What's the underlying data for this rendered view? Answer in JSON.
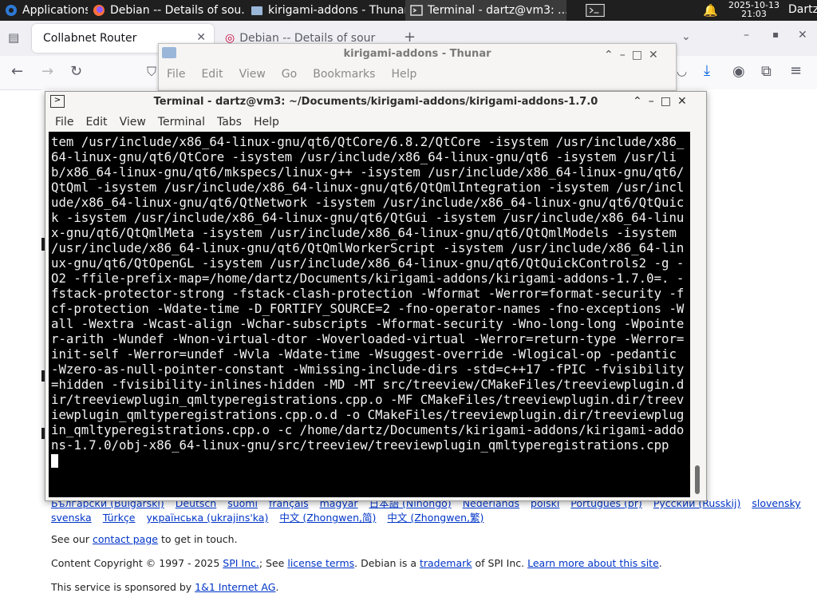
{
  "panel": {
    "apps_label": "Applications",
    "tasks": [
      {
        "label": "Debian -- Details of sou..."
      },
      {
        "label": "kirigami-addons - Thunar"
      },
      {
        "label": "Terminal - dartz@vm3: ..."
      }
    ],
    "date": "2025-10-13",
    "time": "21:03",
    "user": "Dartz"
  },
  "firefox": {
    "tab1_label": "Collabnet Router",
    "tab2_label": "Debian -- Details of sour"
  },
  "thunar": {
    "title": "kirigami-addons - Thunar",
    "menu": [
      "File",
      "Edit",
      "View",
      "Go",
      "Bookmarks",
      "Help"
    ]
  },
  "terminal": {
    "title": "Terminal - dartz@vm3: ~/Documents/kirigami-addons/kirigami-addons-1.7.0",
    "menu": [
      "File",
      "Edit",
      "View",
      "Terminal",
      "Tabs",
      "Help"
    ],
    "output": "tem /usr/include/x86_64-linux-gnu/qt6/QtCore/6.8.2/QtCore -isystem /usr/include/x86_64-linux-gnu/qt6/QtCore -isystem /usr/include/x86_64-linux-gnu/qt6 -isystem /usr/lib/x86_64-linux-gnu/qt6/mkspecs/linux-g++ -isystem /usr/include/x86_64-linux-gnu/qt6/QtQml -isystem /usr/include/x86_64-linux-gnu/qt6/QtQmlIntegration -isystem /usr/include/x86_64-linux-gnu/qt6/QtNetwork -isystem /usr/include/x86_64-linux-gnu/qt6/QtQuick -isystem /usr/include/x86_64-linux-gnu/qt6/QtGui -isystem /usr/include/x86_64-linux-gnu/qt6/QtQmlMeta -isystem /usr/include/x86_64-linux-gnu/qt6/QtQmlModels -isystem /usr/include/x86_64-linux-gnu/qt6/QtQmlWorkerScript -isystem /usr/include/x86_64-linux-gnu/qt6/QtOpenGL -isystem /usr/include/x86_64-linux-gnu/qt6/QtQuickControls2 -g -O2 -ffile-prefix-map=/home/dartz/Documents/kirigami-addons/kirigami-addons-1.7.0=. -fstack-protector-strong -fstack-clash-protection -Wformat -Werror=format-security -fcf-protection -Wdate-time -D_FORTIFY_SOURCE=2 -fno-operator-names -fno-exceptions -Wall -Wextra -Wcast-align -Wchar-subscripts -Wformat-security -Wno-long-long -Wpointer-arith -Wundef -Wnon-virtual-dtor -Woverloaded-virtual -Werror=return-type -Werror=init-self -Werror=undef -Wvla -Wdate-time -Wsuggest-override -Wlogical-op -pedantic -Wzero-as-null-pointer-constant -Wmissing-include-dirs -std=c++17 -fPIC -fvisibility=hidden -fvisibility-inlines-hidden -MD -MT src/treeview/CMakeFiles/treeviewplugin.dir/treeviewplugin_qmltyperegistrations.cpp.o -MF CMakeFiles/treeviewplugin.dir/treeviewplugin_qmltyperegistrations.cpp.o.d -o CMakeFiles/treeviewplugin.dir/treeviewplugin_qmltyperegistrations.cpp.o -c /home/dartz/Documents/kirigami-addons/kirigami-addons-1.7.0/obj-x86_64-linux-gnu/src/treeview/treeviewplugin_qmltyperegistrations.cpp"
  },
  "web": {
    "lang_row1": [
      "Български (Bulgarski)",
      "Deutsch",
      "suomi",
      "français",
      "magyar",
      "日本語 (Nihongo)",
      "Nederlands",
      "polski",
      "Português (br)",
      "Русский (Russkij)",
      "slovensky"
    ],
    "lang_row2": [
      "svenska",
      "Türkçe",
      "українська (ukrajins'ka)",
      "中文 (Zhongwen,简)",
      "中文 (Zhongwen,繁)"
    ],
    "contact_pre": "See our ",
    "contact_link": "contact page",
    "contact_post": " to get in touch.",
    "copyright_pre": "Content Copyright © 1997 - 2025 ",
    "spi_link": "SPI Inc.",
    "copyright_mid1": "; See ",
    "license_link": "license terms",
    "copyright_mid2": ". Debian is a ",
    "trademark_link": "trademark",
    "copyright_mid3": " of SPI Inc. ",
    "learn_link": "Learn more about this site",
    "copyright_end": ".",
    "sponsor_pre": "This service is sponsored by ",
    "sponsor_link": "1&1 Internet AG",
    "sponsor_end": "."
  }
}
